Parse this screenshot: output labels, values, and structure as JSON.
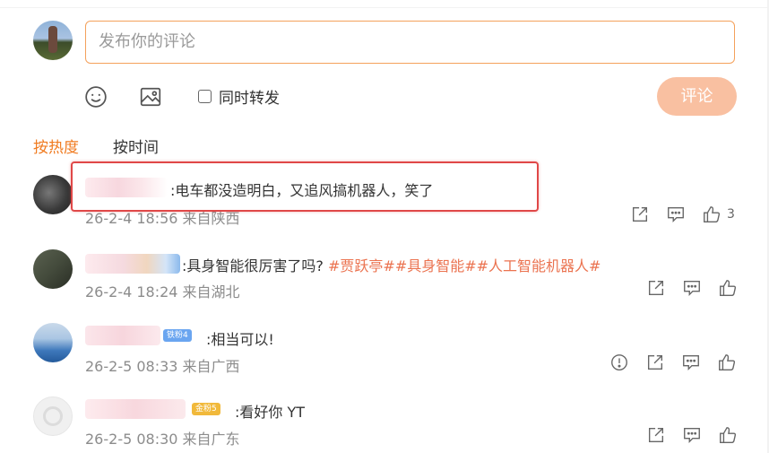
{
  "composer": {
    "placeholder": "发布你的评论",
    "checkbox_label": "同时转发",
    "submit_label": "评论"
  },
  "sort": {
    "hot_label": "按热度",
    "time_label": "按时间"
  },
  "comments": [
    {
      "text": ":电车都没造明白，又追风搞机器人，笑了",
      "meta": "26-2-4 18:56 来自陕西",
      "like_count": "3",
      "highlighted": true
    },
    {
      "text_prefix": ":具身智能很厉害了吗? ",
      "hashtags": [
        "#贾跃亭#",
        "#具身智能#",
        "#人工智能机器人#"
      ],
      "meta": "26-2-4 18:24 来自湖北"
    },
    {
      "badge": "铁粉4",
      "text": ":相当可以!",
      "meta": "26-2-5 08:33 来自广西"
    },
    {
      "badge": "金粉5",
      "text": ":看好你 YT",
      "meta": "26-2-5 08:30 来自广东"
    }
  ],
  "icons": {
    "emoji": "emoji-icon",
    "image": "image-icon",
    "share": "share-icon",
    "reply": "comment-icon",
    "like": "thumbs-up-icon",
    "report": "report-icon"
  },
  "colors": {
    "accent": "#f07b20",
    "hashtag": "#eb7350",
    "input_border": "#f4a15b",
    "button": "#f9c0a1",
    "highlight": "#e04848"
  }
}
